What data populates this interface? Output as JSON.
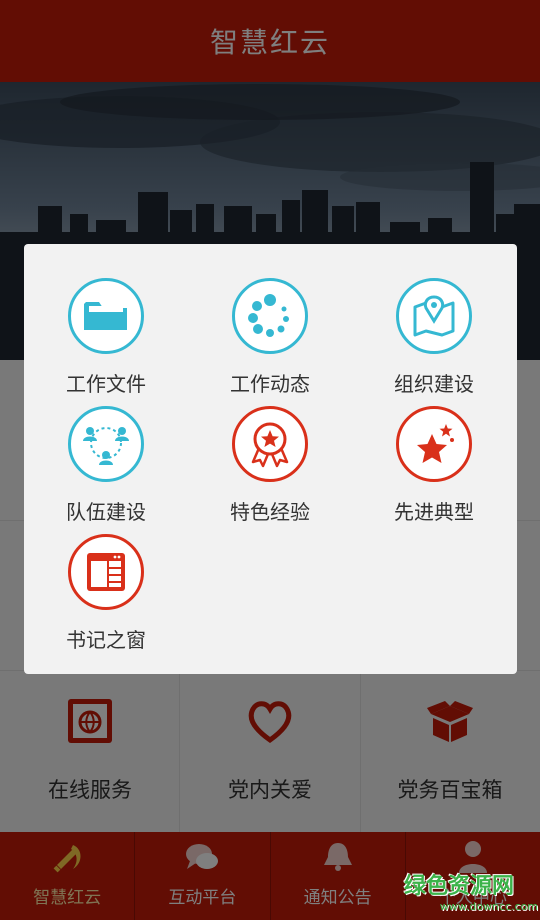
{
  "header": {
    "title": "智慧红云"
  },
  "services": [
    {
      "label": "在线服务",
      "icon": "online-service-icon"
    },
    {
      "label": "党内关爱",
      "icon": "heart-icon"
    },
    {
      "label": "党务百宝箱",
      "icon": "toolbox-icon"
    }
  ],
  "tabs": [
    {
      "label": "智慧红云",
      "icon": "party-emblem-icon",
      "active": true
    },
    {
      "label": "互动平台",
      "icon": "chat-bubbles-icon",
      "active": false
    },
    {
      "label": "通知公告",
      "icon": "bell-icon",
      "active": false
    },
    {
      "label": "个人中心",
      "icon": "person-icon",
      "active": false
    }
  ],
  "menu": [
    {
      "label": "工作文件",
      "icon": "folder-icon",
      "color": "#35b8d2"
    },
    {
      "label": "工作动态",
      "icon": "loading-dots-icon",
      "color": "#35b8d2"
    },
    {
      "label": "组织建设",
      "icon": "map-pin-icon",
      "color": "#35b8d2"
    },
    {
      "label": "队伍建设",
      "icon": "team-icon",
      "color": "#35b8d2"
    },
    {
      "label": "特色经验",
      "icon": "badge-star-icon",
      "color": "#d9301a"
    },
    {
      "label": "先进典型",
      "icon": "stars-icon",
      "color": "#d9301a"
    },
    {
      "label": "书记之窗",
      "icon": "window-icon",
      "color": "#d9301a"
    }
  ],
  "watermark": {
    "text": "绿色资源网",
    "url": "www.downcc.com"
  },
  "colors": {
    "brand_red": "#c41a08",
    "accent_blue": "#35b8d2",
    "accent_red": "#d9301a"
  }
}
